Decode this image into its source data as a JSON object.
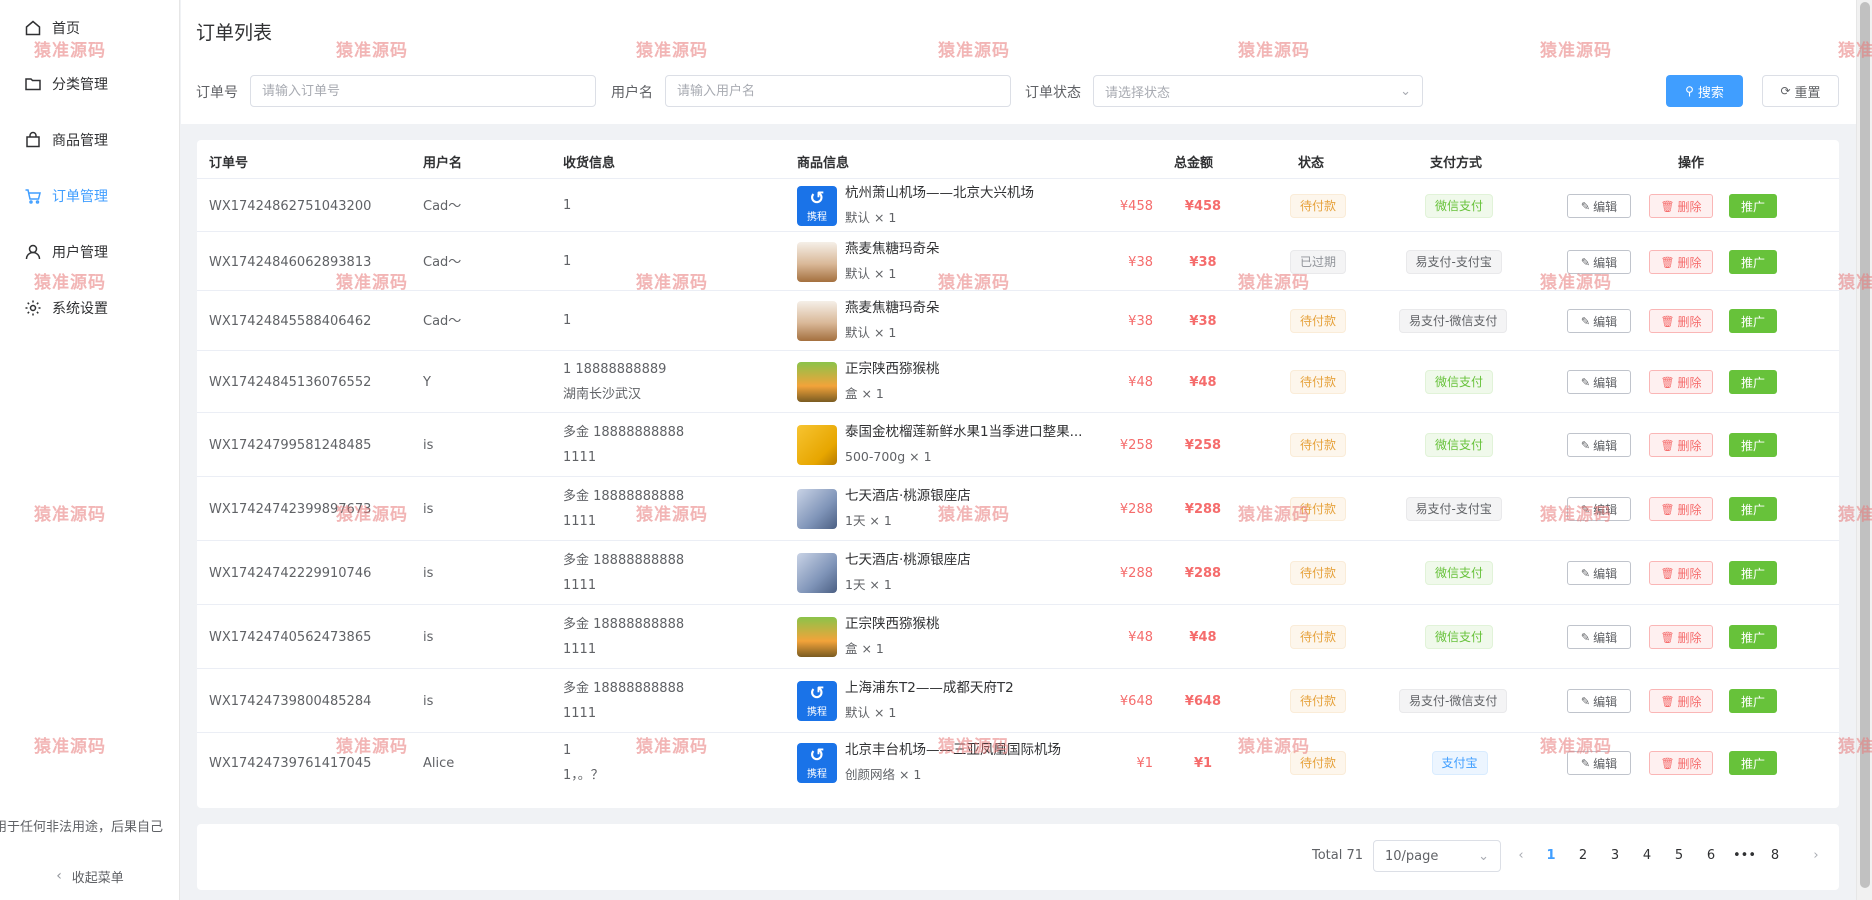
{
  "sidebar": {
    "items": [
      {
        "label": "首页",
        "icon": "home-icon"
      },
      {
        "label": "分类管理",
        "icon": "folder-icon"
      },
      {
        "label": "商品管理",
        "icon": "shopping-bag-icon"
      },
      {
        "label": "订单管理",
        "icon": "cart-icon",
        "active": true
      },
      {
        "label": "用户管理",
        "icon": "user-icon"
      },
      {
        "label": "系统设置",
        "icon": "gear-icon"
      }
    ],
    "notice": "用于任何非法用途，后果自己",
    "collapse_label": "收起菜单"
  },
  "header": {
    "title": "订单列表"
  },
  "search": {
    "order_no_label": "订单号",
    "order_no_placeholder": "请输入订单号",
    "username_label": "用户名",
    "username_placeholder": "请输入用户名",
    "status_label": "订单状态",
    "status_placeholder": "请选择状态",
    "search_button": "搜索",
    "reset_button": "重置"
  },
  "table": {
    "columns": {
      "order_no": "订单号",
      "username": "用户名",
      "shipping": "收货信息",
      "goods": "商品信息",
      "total": "总金额",
      "status": "状态",
      "payment": "支付方式",
      "actions": "操作"
    },
    "actions": {
      "edit": "编辑",
      "delete": "删除",
      "promote": "推广"
    },
    "thumb_text": "携程",
    "rows": [
      {
        "order_no": "WX17424862751043200",
        "user": "Cad～",
        "ship1": "1",
        "ship2": "",
        "thumb": "brand",
        "goods_name": "杭州萧山机场——北京大兴机场",
        "goods_spec": "默认 × 1",
        "price": "¥458",
        "total": "¥458",
        "status": "待付款",
        "status_type": "warning",
        "payment": "微信支付",
        "payment_type": "success"
      },
      {
        "order_no": "WX17424846062893813",
        "user": "Cad～",
        "ship1": "1",
        "ship2": "",
        "thumb": "coffee",
        "goods_name": "燕麦焦糖玛奇朵",
        "goods_spec": "默认 × 1",
        "price": "¥38",
        "total": "¥38",
        "status": "已过期",
        "status_type": "info",
        "payment": "易支付-支付宝",
        "payment_type": "gray"
      },
      {
        "order_no": "WX17424845588406462",
        "user": "Cad～",
        "ship1": "1",
        "ship2": "",
        "thumb": "coffee",
        "goods_name": "燕麦焦糖玛奇朵",
        "goods_spec": "默认 × 1",
        "price": "¥38",
        "total": "¥38",
        "status": "待付款",
        "status_type": "warning",
        "payment": "易支付-微信支付",
        "payment_type": "gray"
      },
      {
        "order_no": "WX17424845136076552",
        "user": "Y",
        "ship1": "1 18888888889",
        "ship2": "湖南长沙武汉",
        "thumb": "kiwi",
        "goods_name": "正宗陕西猕猴桃",
        "goods_spec": "盒 × 1",
        "price": "¥48",
        "total": "¥48",
        "status": "待付款",
        "status_type": "warning",
        "payment": "微信支付",
        "payment_type": "success"
      },
      {
        "order_no": "WX17424799581248485",
        "user": "is",
        "ship1": "多金 18888888888",
        "ship2": "1111",
        "thumb": "durian",
        "goods_name": "泰国金枕榴莲新鲜水果1当季进口整果...",
        "goods_spec": "500-700g × 1",
        "price": "¥258",
        "total": "¥258",
        "status": "待付款",
        "status_type": "warning",
        "payment": "微信支付",
        "payment_type": "success"
      },
      {
        "order_no": "WX17424742399897673",
        "user": "is",
        "ship1": "多金 18888888888",
        "ship2": "1111",
        "thumb": "hotel",
        "goods_name": "七天酒店·桃源银座店",
        "goods_spec": "1天 × 1",
        "price": "¥288",
        "total": "¥288",
        "status": "待付款",
        "status_type": "warning",
        "payment": "易支付-支付宝",
        "payment_type": "gray"
      },
      {
        "order_no": "WX17424742229910746",
        "user": "is",
        "ship1": "多金 18888888888",
        "ship2": "1111",
        "thumb": "hotel",
        "goods_name": "七天酒店·桃源银座店",
        "goods_spec": "1天 × 1",
        "price": "¥288",
        "total": "¥288",
        "status": "待付款",
        "status_type": "warning",
        "payment": "微信支付",
        "payment_type": "success"
      },
      {
        "order_no": "WX17424740562473865",
        "user": "is",
        "ship1": "多金 18888888888",
        "ship2": "1111",
        "thumb": "kiwi",
        "goods_name": "正宗陕西猕猴桃",
        "goods_spec": "盒 × 1",
        "price": "¥48",
        "total": "¥48",
        "status": "待付款",
        "status_type": "warning",
        "payment": "微信支付",
        "payment_type": "success"
      },
      {
        "order_no": "WX17424739800485284",
        "user": "is",
        "ship1": "多金 18888888888",
        "ship2": "1111",
        "thumb": "brand",
        "goods_name": "上海浦东T2——成都天府T2",
        "goods_spec": "默认 × 1",
        "price": "¥648",
        "total": "¥648",
        "status": "待付款",
        "status_type": "warning",
        "payment": "易支付-微信支付",
        "payment_type": "gray"
      },
      {
        "order_no": "WX17424739761417045",
        "user": "Alice",
        "ship1": "1",
        "ship2": "1，。？",
        "thumb": "brand",
        "goods_name": "北京丰台机场——三亚凤凰国际机场",
        "goods_spec": "创颜网络 × 1",
        "price": "¥1",
        "total": "¥1",
        "status": "待付款",
        "status_type": "warning",
        "payment": "支付宝",
        "payment_type": "primary"
      }
    ]
  },
  "pagination": {
    "total_text": "Total 71",
    "page_size": "10/page",
    "pages": [
      "1",
      "2",
      "3",
      "4",
      "5",
      "6",
      "•••",
      "8"
    ],
    "current": "1"
  },
  "watermark": "猿准源码",
  "colors": {
    "primary": "#409eff",
    "danger": "#f56c6c",
    "success": "#67c23a",
    "warning": "#e6a23c"
  }
}
